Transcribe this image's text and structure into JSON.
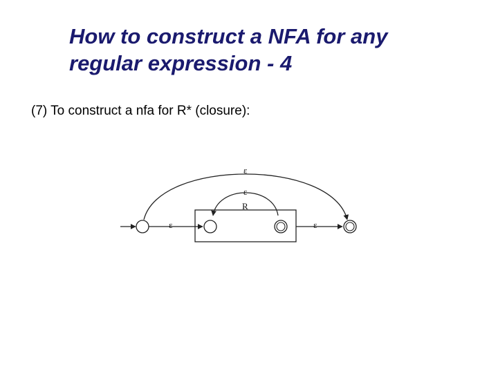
{
  "title": "How to construct a NFA for any regular expression - 4",
  "body": "(7) To construct a nfa for R* (closure):",
  "diagram": {
    "box_label": "R",
    "eps_top_outer": "ε",
    "eps_top_inner": "ε",
    "eps_left": "ε",
    "eps_right": "ε"
  }
}
